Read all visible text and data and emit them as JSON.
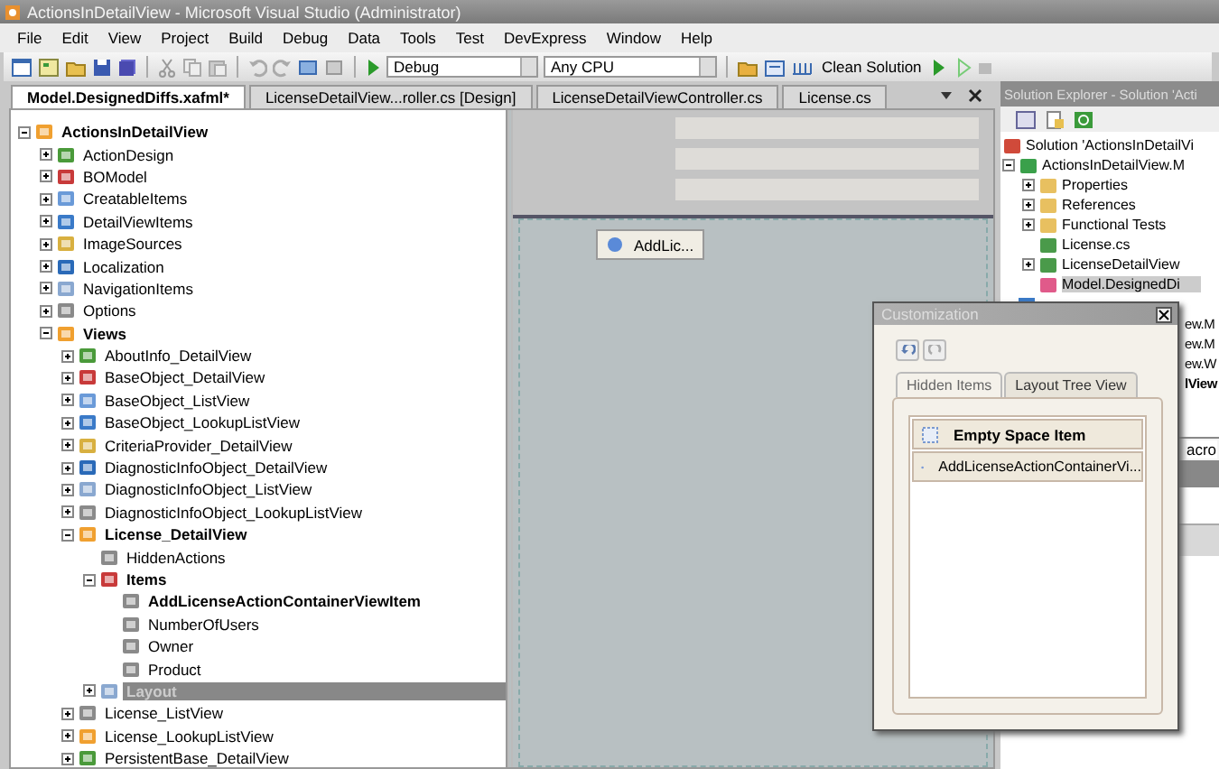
{
  "window": {
    "title": "ActionsInDetailView - Microsoft Visual Studio (Administrator)"
  },
  "menu": [
    "File",
    "Edit",
    "View",
    "Project",
    "Build",
    "Debug",
    "Data",
    "Tools",
    "Test",
    "DevExpress",
    "Window",
    "Help"
  ],
  "toolbar": {
    "configuration": "Debug",
    "platform": "Any CPU",
    "clean_button": "Clean Solution"
  },
  "doc_tabs": [
    {
      "label": "Model.DesignedDiffs.xafml*",
      "selected": true
    },
    {
      "label": "LicenseDetailView...roller.cs [Design]",
      "selected": false
    },
    {
      "label": "LicenseDetailViewController.cs",
      "selected": false
    },
    {
      "label": "License.cs",
      "selected": false
    }
  ],
  "tree": {
    "label": "ActionsInDetailView",
    "bold": true,
    "expanded": true,
    "selected": false,
    "children": [
      {
        "label": "ActionDesign",
        "expanded": false,
        "selected": false
      },
      {
        "label": "BOModel",
        "expanded": false,
        "selected": false
      },
      {
        "label": "CreatableItems",
        "expanded": false,
        "selected": false
      },
      {
        "label": "DetailViewItems",
        "expanded": false,
        "selected": false
      },
      {
        "label": "ImageSources",
        "expanded": false,
        "selected": false
      },
      {
        "label": "Localization",
        "expanded": false,
        "selected": false
      },
      {
        "label": "NavigationItems",
        "expanded": false,
        "selected": false
      },
      {
        "label": "Options",
        "expanded": false,
        "selected": false
      },
      {
        "label": "Views",
        "bold": true,
        "expanded": true,
        "selected": false,
        "children": [
          {
            "label": "AboutInfo_DetailView",
            "expanded": false,
            "selected": false
          },
          {
            "label": "BaseObject_DetailView",
            "expanded": false,
            "selected": false
          },
          {
            "label": "BaseObject_ListView",
            "expanded": false,
            "selected": false
          },
          {
            "label": "BaseObject_LookupListView",
            "expanded": false,
            "selected": false
          },
          {
            "label": "CriteriaProvider_DetailView",
            "expanded": false,
            "selected": false
          },
          {
            "label": "DiagnosticInfoObject_DetailView",
            "expanded": false,
            "selected": false
          },
          {
            "label": "DiagnosticInfoObject_ListView",
            "expanded": false,
            "selected": false
          },
          {
            "label": "DiagnosticInfoObject_LookupListView",
            "expanded": false,
            "selected": false
          },
          {
            "label": "License_DetailView",
            "bold": true,
            "expanded": true,
            "selected": false,
            "children": [
              {
                "label": "HiddenActions",
                "selected": false
              },
              {
                "label": "Items",
                "bold": true,
                "expanded": true,
                "selected": false,
                "children": [
                  {
                    "label": "AddLicenseActionContainerViewItem",
                    "bold": true,
                    "selected": false
                  },
                  {
                    "label": "NumberOfUsers",
                    "selected": false
                  },
                  {
                    "label": "Owner",
                    "selected": false
                  },
                  {
                    "label": "Product",
                    "selected": false
                  }
                ]
              },
              {
                "label": "Layout",
                "expanded": false,
                "selected": true
              }
            ]
          },
          {
            "label": "License_ListView",
            "expanded": false,
            "selected": false
          },
          {
            "label": "License_LookupListView",
            "expanded": false,
            "selected": false
          },
          {
            "label": "PersistentBase_DetailView",
            "expanded": false,
            "selected": false
          }
        ]
      }
    ]
  },
  "designer": {
    "action_button": "AddLic..."
  },
  "solution_explorer": {
    "title": "Solution Explorer - Solution 'Acti",
    "tree": {
      "label": "Solution 'ActionsInDetailVi",
      "selected": false,
      "children": [
        {
          "label": "ActionsInDetailView.M",
          "expanded": true,
          "selected": false,
          "children": [
            {
              "label": "Properties",
              "expanded": false,
              "selected": false
            },
            {
              "label": "References",
              "expanded": false,
              "selected": false
            },
            {
              "label": "Functional Tests",
              "expanded": false,
              "selected": false
            },
            {
              "label": "License.cs",
              "selected": false
            },
            {
              "label": "LicenseDetailView",
              "expanded": false,
              "selected": false
            },
            {
              "label": "Model.DesignedDi",
              "selected": true
            }
          ]
        }
      ]
    },
    "hidden_rows": [
      {
        "label": "ew.M",
        "bold": false
      },
      {
        "label": "ew.M",
        "bold": false
      },
      {
        "label": "ew.W",
        "bold": false
      },
      {
        "label": "lView",
        "bold": true
      }
    ],
    "bottom_tab": "acro"
  },
  "customization": {
    "title": "Customization",
    "tabs": [
      {
        "label": "Hidden Items",
        "selected": true
      },
      {
        "label": "Layout Tree View",
        "selected": false
      }
    ],
    "items": [
      {
        "label": "Empty Space Item",
        "kind": "empty",
        "bold": true
      },
      {
        "label": "AddLicenseActionContainerVi...",
        "kind": "action",
        "bold": false
      }
    ]
  }
}
